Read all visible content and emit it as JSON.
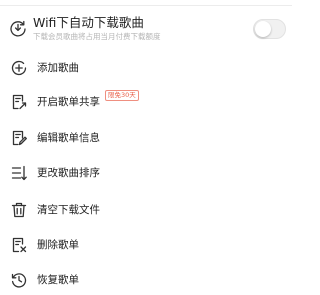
{
  "wifi_download": {
    "title": "Wifi下自动下载歌曲",
    "subtitle": "下载会员歌曲将占用当月付费下载额度",
    "toggle_on": false
  },
  "menu": [
    {
      "label": "添加歌曲",
      "icon": "add-circle-icon"
    },
    {
      "label": "开启歌单共享",
      "icon": "share-playlist-icon",
      "badge": "限免30天",
      "badge_color": "#e8604a"
    },
    {
      "label": "编辑歌单信息",
      "icon": "edit-document-icon"
    },
    {
      "label": "更改歌曲排序",
      "icon": "sort-icon"
    },
    {
      "label": "清空下载文件",
      "icon": "trash-icon"
    },
    {
      "label": "删除歌单",
      "icon": "delete-list-icon"
    },
    {
      "label": "恢复歌单",
      "icon": "restore-clock-icon"
    }
  ]
}
